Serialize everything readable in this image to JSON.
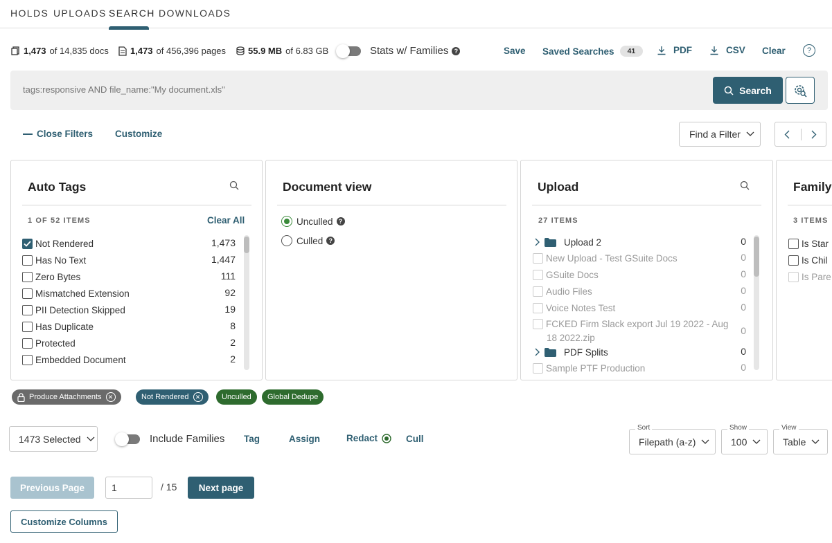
{
  "tabs": [
    "HOLDS",
    "UPLOADS",
    "SEARCH",
    "DOWNLOADS"
  ],
  "active_tab": "SEARCH",
  "stats": {
    "docs_bold": "1,473",
    "docs_rest": "of 14,835 docs",
    "pages_bold": "1,473",
    "pages_rest": "of 456,396 pages",
    "size_bold": "55.9 MB",
    "size_rest": "of 6.83 GB",
    "families_label": "Stats w/ Families"
  },
  "toolbar": {
    "save": "Save",
    "saved_searches": "Saved Searches",
    "saved_count": "41",
    "pdf": "PDF",
    "csv": "CSV",
    "clear": "Clear",
    "help": "?"
  },
  "search": {
    "placeholder": "tags:responsive AND file_name:\"My document.xls\"",
    "button": "Search"
  },
  "filters": {
    "close_filters": "Close Filters",
    "customize": "Customize",
    "find_filter": "Find a Filter"
  },
  "auto_tags": {
    "title": "Auto Tags",
    "count_label": "1 OF 52 ITEMS",
    "clear_all": "Clear All",
    "items": [
      {
        "label": "Not Rendered",
        "count": "1,473",
        "checked": true
      },
      {
        "label": "Has No Text",
        "count": "1,447",
        "checked": false
      },
      {
        "label": "Zero Bytes",
        "count": "111",
        "checked": false
      },
      {
        "label": "Mismatched Extension",
        "count": "92",
        "checked": false
      },
      {
        "label": "PII Detection Skipped",
        "count": "19",
        "checked": false
      },
      {
        "label": "Has Duplicate",
        "count": "8",
        "checked": false
      },
      {
        "label": "Protected",
        "count": "2",
        "checked": false
      },
      {
        "label": "Embedded Document",
        "count": "2",
        "checked": false
      }
    ]
  },
  "document_view": {
    "title": "Document view",
    "options": [
      {
        "label": "Unculled",
        "selected": true
      },
      {
        "label": "Culled",
        "selected": false
      }
    ]
  },
  "upload": {
    "title": "Upload",
    "count_label": "27 ITEMS",
    "items": [
      {
        "label": "Upload 2",
        "count": "0",
        "folder": true
      },
      {
        "label": "New Upload - Test GSuite Docs",
        "count": "0",
        "folder": false
      },
      {
        "label": "GSuite Docs",
        "count": "0",
        "folder": false
      },
      {
        "label": "Audio Files",
        "count": "0",
        "folder": false
      },
      {
        "label": "Voice Notes Test",
        "count": "0",
        "folder": false
      },
      {
        "label": "FCKED Firm Slack export Jul 19 2022 - Aug",
        "label2": "18 2022.zip",
        "count": "0",
        "folder": false
      },
      {
        "label": "PDF Splits",
        "count": "0",
        "folder": true
      },
      {
        "label": "Sample PTF Production",
        "count": "0",
        "folder": false
      }
    ]
  },
  "family": {
    "title": "Family",
    "count_label": "3 ITEMS",
    "items": [
      "Is Star",
      "Is Chil",
      "Is Pare"
    ]
  },
  "chips": [
    "Produce Attachments",
    "Not Rendered",
    "Unculled",
    "Global Dedupe"
  ],
  "actions": {
    "selected": "1473 Selected",
    "include_families": "Include Families",
    "tag": "Tag",
    "assign": "Assign",
    "redact": "Redact",
    "cull": "Cull"
  },
  "sort": {
    "label": "Sort",
    "value": "Filepath (a-z)"
  },
  "show": {
    "label": "Show",
    "value": "100"
  },
  "view": {
    "label": "View",
    "value": "Table"
  },
  "pagination": {
    "previous": "Previous Page",
    "current": "1",
    "total": "/ 15",
    "next": "Next page"
  },
  "customize_columns": "Customize Columns",
  "colors": {
    "accent": "#2f5f72",
    "green": "#2e6b2e",
    "chip_gray": "#6a6a6a"
  }
}
